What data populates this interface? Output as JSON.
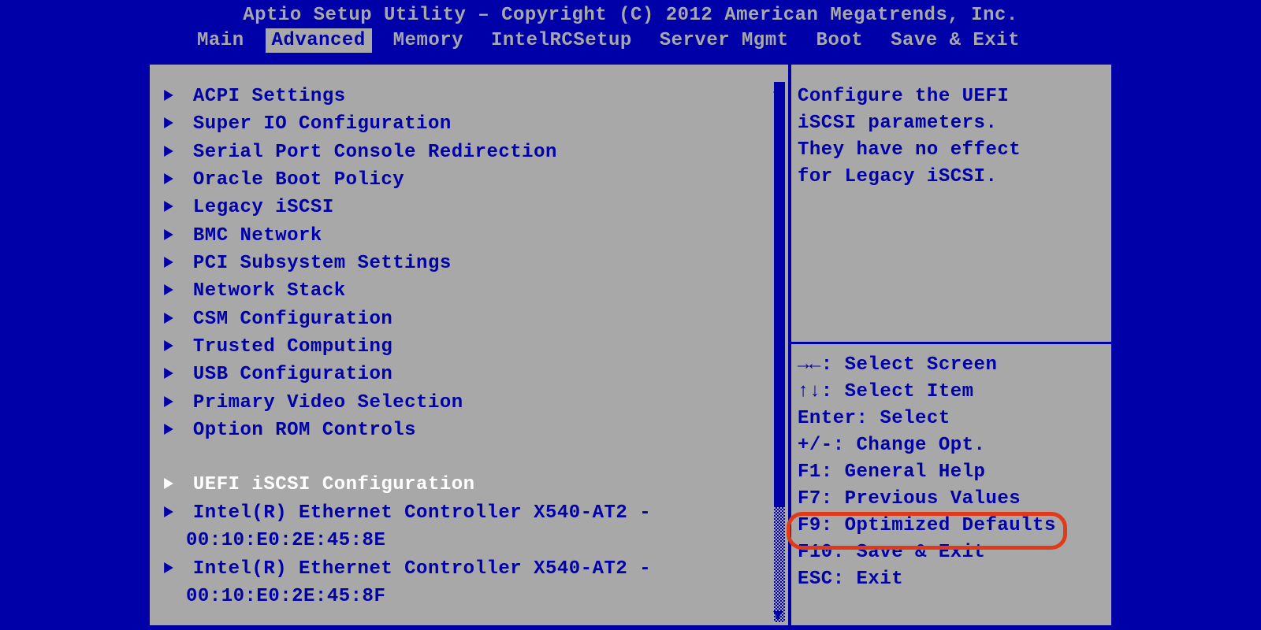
{
  "title": "Aptio Setup Utility – Copyright (C) 2012 American Megatrends, Inc.",
  "tabs": [
    {
      "label": "Main",
      "active": false
    },
    {
      "label": "Advanced",
      "active": true
    },
    {
      "label": "Memory",
      "active": false
    },
    {
      "label": "IntelRCSetup",
      "active": false
    },
    {
      "label": "Server Mgmt",
      "active": false
    },
    {
      "label": "Boot",
      "active": false
    },
    {
      "label": "Save & Exit",
      "active": false
    }
  ],
  "menu": {
    "items": [
      {
        "label": "ACPI Settings"
      },
      {
        "label": "Super IO Configuration"
      },
      {
        "label": "Serial Port Console Redirection"
      },
      {
        "label": "Oracle Boot Policy"
      },
      {
        "label": "Legacy iSCSI"
      },
      {
        "label": "BMC Network"
      },
      {
        "label": "PCI Subsystem Settings"
      },
      {
        "label": "Network Stack"
      },
      {
        "label": "CSM Configuration"
      },
      {
        "label": "Trusted Computing"
      },
      {
        "label": "USB Configuration"
      },
      {
        "label": "Primary Video Selection"
      },
      {
        "label": "Option ROM Controls"
      }
    ],
    "selected": {
      "label": "UEFI iSCSI Configuration"
    },
    "devices": [
      {
        "line1": "Intel(R) Ethernet Controller X540-AT2 -",
        "line2": "00:10:E0:2E:45:8E"
      },
      {
        "line1": "Intel(R) Ethernet Controller X540-AT2 -",
        "line2": "00:10:E0:2E:45:8F"
      }
    ]
  },
  "help": {
    "l1": "Configure the UEFI",
    "l2": "iSCSI parameters.",
    "l3": "They have no effect",
    "l4": "for Legacy iSCSI."
  },
  "keys": {
    "k0": "→←: Select Screen",
    "k1": "↑↓: Select Item",
    "k2": "Enter: Select",
    "k3": "+/-: Change Opt.",
    "k4": "F1: General Help",
    "k5": "F7: Previous Values",
    "k6": "F9: Optimized Defaults",
    "k7": "F10: Save & Exit",
    "k8": "ESC: Exit"
  }
}
